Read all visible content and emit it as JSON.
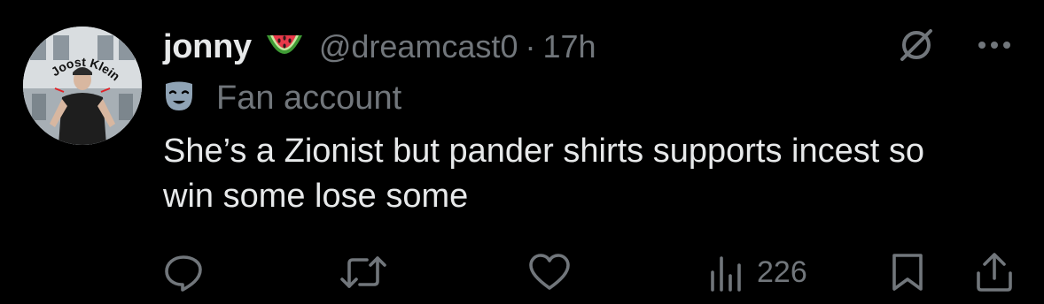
{
  "tweet": {
    "display_name": "jonny",
    "name_emoji": "watermelon-emoji",
    "handle": "@dreamcast0",
    "separator": "·",
    "time": "17h",
    "label": "Fan account",
    "label_icon": "theater-mask-icon",
    "text": "She’s a Zionist but pander shirts supports incest so win some lose some",
    "views": "226"
  },
  "avatar": {
    "caption": "Joost Klein"
  },
  "actions": {
    "reply_icon": "reply-icon",
    "retweet_icon": "retweet-icon",
    "like_icon": "heart-icon",
    "views_icon": "views-icon",
    "bookmark_icon": "bookmark-icon",
    "share_icon": "share-icon"
  },
  "colors": {
    "background": "#000000",
    "primary_text": "#e7e9ea",
    "secondary_text": "#71767b",
    "label_icon": "#8899a6"
  }
}
